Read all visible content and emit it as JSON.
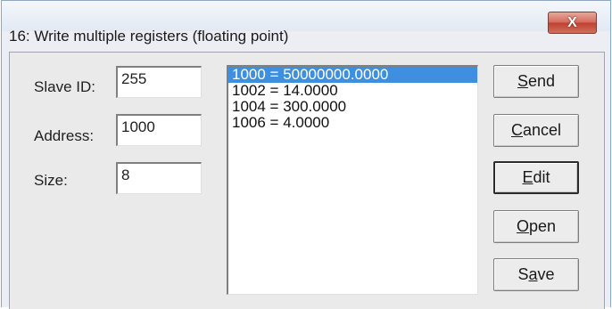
{
  "window": {
    "title": "16: Write multiple registers (floating point)",
    "close_glyph": "X"
  },
  "fields": {
    "slave_id": {
      "label": "Slave ID:",
      "value": "255"
    },
    "address": {
      "label": "Address:",
      "value": "1000"
    },
    "size": {
      "label": "Size:",
      "value": "8"
    }
  },
  "registers": [
    "1000 = 50000000.0000",
    "1002 = 14.0000",
    "1004 = 300.0000",
    "1006 = 4.0000"
  ],
  "selected_register_index": 0,
  "buttons": {
    "send": {
      "mnemonic": "S",
      "rest": "end"
    },
    "cancel": {
      "mnemonic": "C",
      "rest": "ancel"
    },
    "edit": {
      "mnemonic": "E",
      "rest": "dit"
    },
    "open": {
      "mnemonic": "O",
      "rest": "pen"
    },
    "save_pre": "S",
    "save_mnemonic": "a",
    "save_post": "ve"
  }
}
